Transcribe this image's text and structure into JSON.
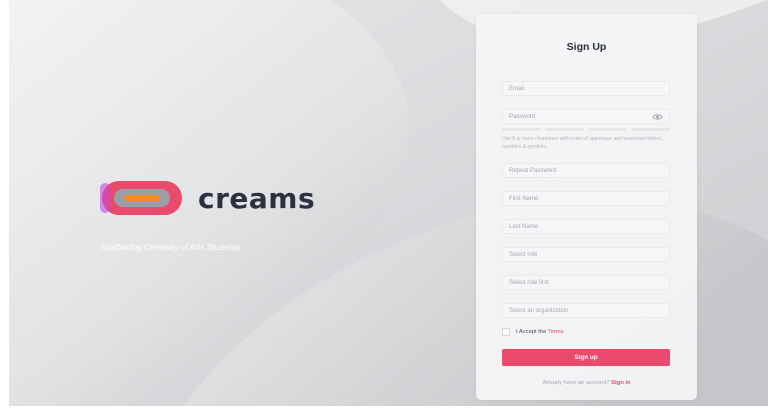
{
  "brand": {
    "name": "creams",
    "tagline": "Scaffolding Creativity of Arts Students"
  },
  "form": {
    "title": "Sign Up",
    "email_placeholder": "Email",
    "password_placeholder": "Password",
    "password_hint": "Use 8 or more characters with a mix of uppercase and lowercase letters, numbers & symbols.",
    "repeat_password_placeholder": "Repeat Password",
    "first_name_placeholder": "First Name",
    "last_name_placeholder": "Last Name",
    "role_placeholder": "Select role",
    "sub_role_placeholder": "Select role first",
    "organization_placeholder": "Select an organization",
    "accept_label": "I Accept the",
    "terms_link": "Terms",
    "signup_button": "Sign up",
    "already_text": "Already have an account?",
    "signin_link": "Sign in"
  },
  "colors": {
    "accent": "#ea4a6b",
    "logo_ring": "#ea4a6b",
    "logo_bar": "#f28c1c",
    "wordmark": "#2c3140"
  },
  "icons": {
    "password_toggle": "eye-icon"
  }
}
